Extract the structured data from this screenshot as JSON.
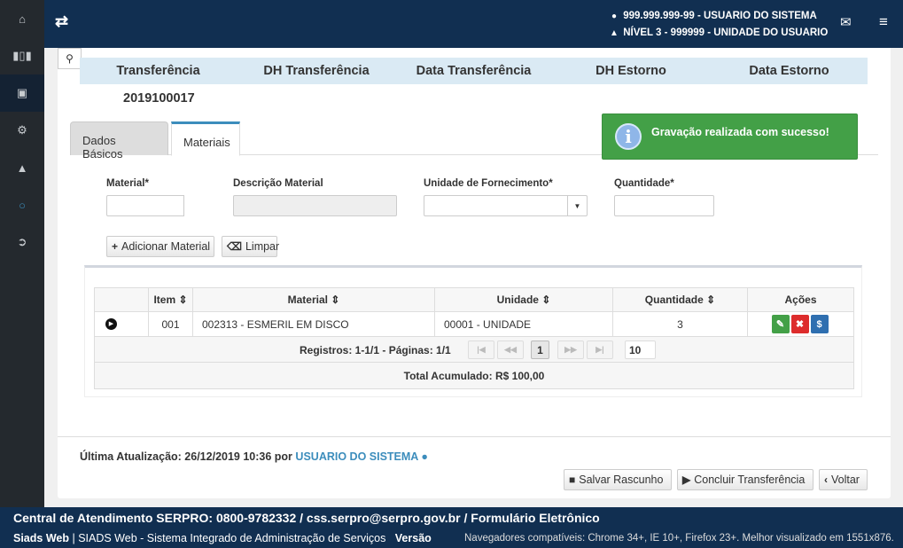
{
  "sidebar": {
    "items": [
      "home-icon",
      "barcode-icon",
      "archive-icon",
      "cogs-icon",
      "graduation-cap-icon",
      "circle-icon",
      "sign-in-icon"
    ]
  },
  "topbar": {
    "user_line": "999.999.999-99 - USUARIO DO SISTEMA",
    "unit_line": "NÍVEL 3 - 999999 - UNIDADE DO USUARIO"
  },
  "header_table": {
    "columns": [
      "Transferência",
      "DH Transferência",
      "Data Transferência",
      "DH Estorno",
      "Data Estorno"
    ],
    "values": [
      "2019100017",
      "",
      "",
      "",
      ""
    ]
  },
  "tabs": [
    {
      "label": "Dados Básicos",
      "active": false
    },
    {
      "label": "Materiais",
      "active": true
    }
  ],
  "toast": {
    "message": "Gravação realizada com sucesso!"
  },
  "form": {
    "material_label": "Material*",
    "descricao_label": "Descrição Material",
    "unidade_label": "Unidade de Fornecimento*",
    "quantidade_label": "Quantidade*",
    "material_value": "",
    "descricao_value": "",
    "unidade_value": "",
    "quantidade_value": "",
    "add_button": "Adicionar Material",
    "clear_button": "Limpar"
  },
  "grid": {
    "headers": [
      "",
      "Item",
      "Material",
      "Unidade",
      "Quantidade",
      "Ações"
    ],
    "rows": [
      {
        "item": "001",
        "material": "002313 - ESMERIL EM DISCO",
        "unidade": "00001 - UNIDADE",
        "quantidade": "3"
      }
    ],
    "registros": "Registros: 1-1/1 - Páginas: 1/1",
    "page": "1",
    "page_size": "10",
    "total": "Total Acumulado: R$ 100,00"
  },
  "footer": {
    "last_update_prefix": "Última Atualização: 26/12/2019 10:36 por",
    "last_update_user": "USUARIO DO SISTEMA",
    "save_draft": "Salvar Rascunho",
    "conclude": "Concluir Transferência",
    "back": "Voltar"
  },
  "bottom": {
    "support": "Central de Atendimento SERPRO: 0800-9782332 / css.serpro@serpro.gov.br / Formulário Eletrônico",
    "brand": "Siads Web",
    "system": "| SIADS Web - Sistema Integrado de Administração de Serviços",
    "version_label": "Versão",
    "browsers": "Navegadores compatíveis: Chrome 34+, IE 10+, Firefox 23+. Melhor visualizado em 1551x876."
  }
}
